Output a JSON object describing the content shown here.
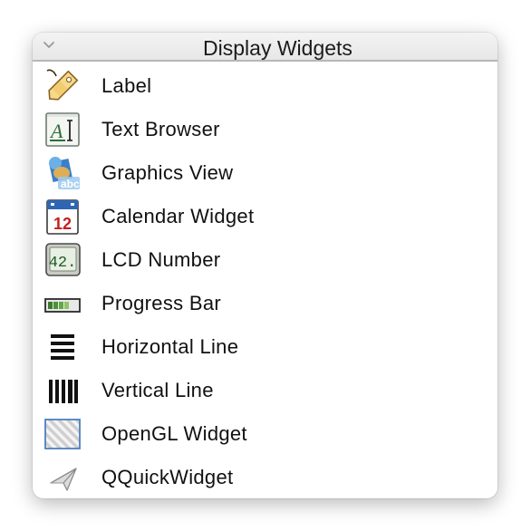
{
  "header": {
    "title": "Display Widgets",
    "collapse_icon": "chevron-down-icon"
  },
  "items": [
    {
      "label": "Label",
      "icon": "label-tag-icon"
    },
    {
      "label": "Text Browser",
      "icon": "text-browser-icon"
    },
    {
      "label": "Graphics View",
      "icon": "graphics-view-icon"
    },
    {
      "label": "Calendar Widget",
      "icon": "calendar-icon",
      "icon_text": "12"
    },
    {
      "label": "LCD Number",
      "icon": "lcd-number-icon",
      "icon_text": "42."
    },
    {
      "label": "Progress Bar",
      "icon": "progress-bar-icon"
    },
    {
      "label": "Horizontal Line",
      "icon": "horizontal-line-icon"
    },
    {
      "label": "Vertical Line",
      "icon": "vertical-line-icon"
    },
    {
      "label": "OpenGL Widget",
      "icon": "opengl-widget-icon"
    },
    {
      "label": "QQuickWidget",
      "icon": "qquick-widget-icon"
    }
  ]
}
